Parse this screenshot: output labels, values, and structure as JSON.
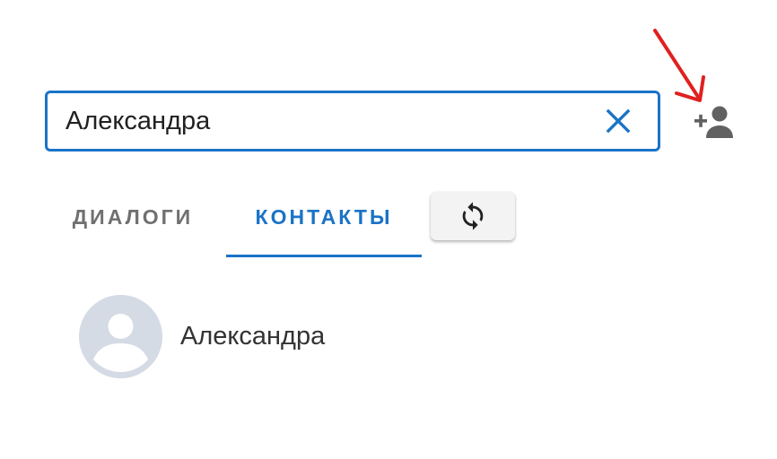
{
  "search": {
    "value": "Александра",
    "placeholder": ""
  },
  "tabs": [
    {
      "label": "ДИАЛОГИ",
      "active": false
    },
    {
      "label": "КОНТАКТЫ",
      "active": true
    }
  ],
  "contacts": [
    {
      "name": "Александра"
    }
  ],
  "icons": {
    "clear": "close-icon",
    "add_contact": "person-add-icon",
    "refresh": "sync-icon",
    "avatar": "person-placeholder-icon"
  },
  "colors": {
    "accent": "#1a73c7",
    "inactive_tab": "#707070",
    "icon_gray": "#616161",
    "avatar_bg": "#d5dbe5",
    "annotation": "#e02020"
  }
}
